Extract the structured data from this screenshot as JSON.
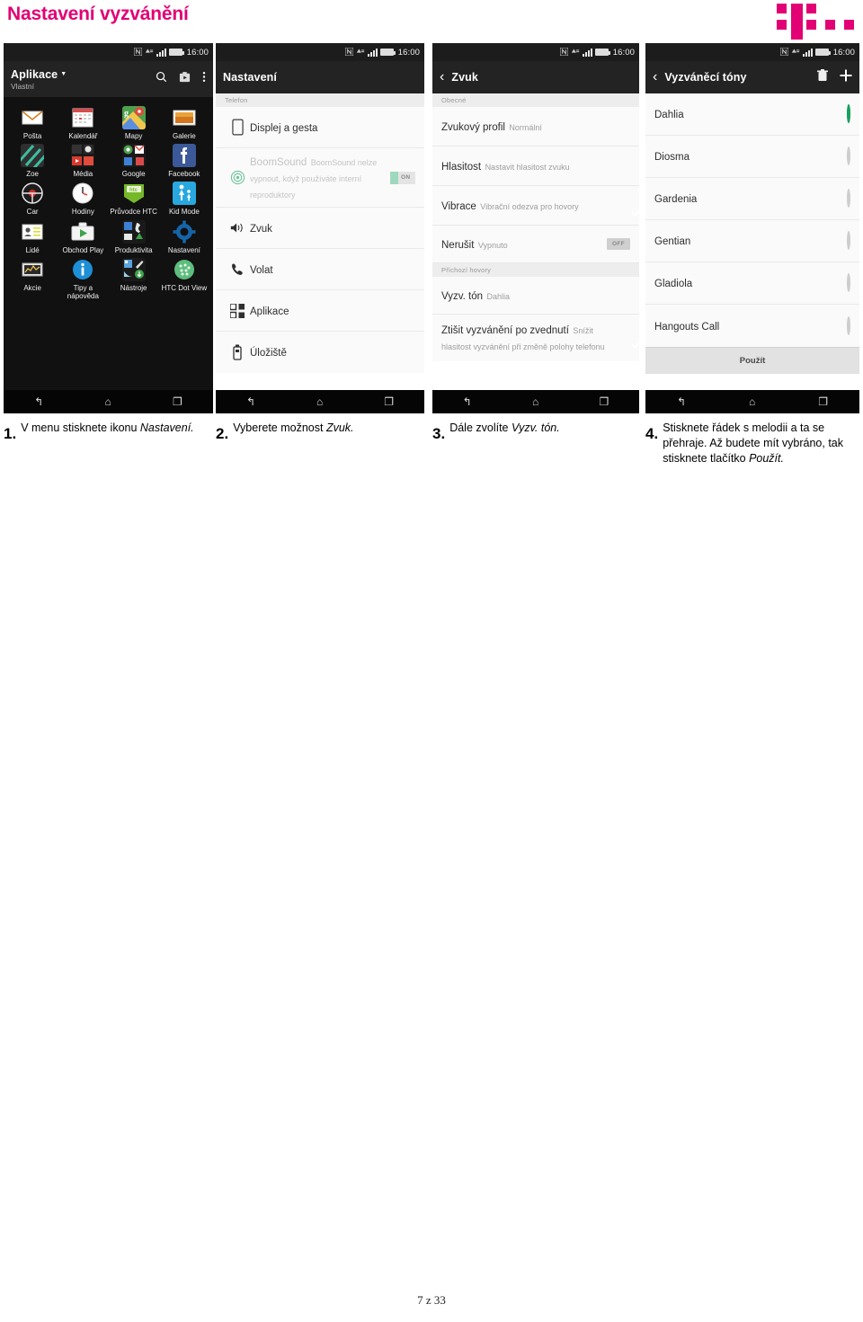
{
  "header": {
    "title": "Nastavení vyzvánění",
    "accent_color": "#e20074",
    "logo": "t-mobile-logo"
  },
  "phones": [
    {
      "id": "app-drawer",
      "statusbar": {
        "icons": [
          "nfc-icon",
          "data-icon",
          "signal-icon",
          "battery-icon"
        ],
        "time": "16:00"
      },
      "appbar": {
        "title": "Aplikace",
        "subtitle": "Vlastní",
        "dropdown_icon": "chevron-down-icon",
        "actions": [
          "search-icon",
          "play-store-icon",
          "overflow-menu-icon"
        ]
      },
      "apps": [
        {
          "label": "Pošta",
          "icon": "mail-icon"
        },
        {
          "label": "Kalendář",
          "icon": "calendar-icon"
        },
        {
          "label": "Mapy",
          "icon": "maps-icon"
        },
        {
          "label": "Galerie",
          "icon": "gallery-icon"
        },
        {
          "label": "Zoe",
          "icon": "zoe-icon"
        },
        {
          "label": "Média",
          "icon": "media-folder-icon"
        },
        {
          "label": "Google",
          "icon": "google-folder-icon"
        },
        {
          "label": "Facebook",
          "icon": "facebook-icon"
        },
        {
          "label": "Car",
          "icon": "car-icon"
        },
        {
          "label": "Hodiny",
          "icon": "clock-icon"
        },
        {
          "label": "Průvodce HTC",
          "icon": "htc-guide-icon"
        },
        {
          "label": "Kid Mode",
          "icon": "kid-mode-icon"
        },
        {
          "label": "Lidé",
          "icon": "people-icon"
        },
        {
          "label": "Obchod Play",
          "icon": "play-store-icon"
        },
        {
          "label": "Produktivita",
          "icon": "productivity-folder-icon"
        },
        {
          "label": "Nastavení",
          "icon": "gear-icon"
        },
        {
          "label": "Akcie",
          "icon": "stocks-icon"
        },
        {
          "label": "Tipy a nápověda",
          "icon": "info-icon"
        },
        {
          "label": "Nástroje",
          "icon": "tools-folder-icon"
        },
        {
          "label": "HTC Dot View",
          "icon": "dot-view-icon"
        }
      ],
      "navbar": [
        "back-icon",
        "home-icon",
        "recents-icon"
      ]
    },
    {
      "id": "settings",
      "statusbar": {
        "time": "16:00"
      },
      "appbar": {
        "title": "Nastavení"
      },
      "section": "Telefon",
      "rows": [
        {
          "title": "Displej a gesta",
          "sub": "",
          "icon": "phone-display-icon",
          "accessory": "none",
          "dim": false
        },
        {
          "title": "BoomSound",
          "sub": "BoomSound nelze vypnout, když používáte interní reproduktory",
          "icon": "boomsound-icon",
          "accessory": "toggle-on",
          "accessory_label": "ON",
          "dim": true
        },
        {
          "title": "Zvuk",
          "sub": "",
          "icon": "speaker-icon",
          "accessory": "none",
          "dim": false
        },
        {
          "title": "Volat",
          "sub": "",
          "icon": "phone-handset-icon",
          "accessory": "none",
          "dim": false
        },
        {
          "title": "Aplikace",
          "sub": "",
          "icon": "apps-grid-icon",
          "accessory": "none",
          "dim": false
        },
        {
          "title": "Úložiště",
          "sub": "",
          "icon": "storage-icon",
          "accessory": "none",
          "dim": false
        }
      ],
      "navbar": [
        "back-icon",
        "home-icon",
        "recents-icon"
      ]
    },
    {
      "id": "sound",
      "statusbar": {
        "time": "16:00"
      },
      "appbar": {
        "title": "Zvuk",
        "back_icon": "back-chevron-icon"
      },
      "sections": [
        {
          "label": "Obecné",
          "rows": [
            {
              "title": "Zvukový profil",
              "sub": "Normální",
              "accessory": "none"
            },
            {
              "title": "Hlasitost",
              "sub": "Nastavit hlasitost zvuku",
              "accessory": "none"
            },
            {
              "title": "Vibrace",
              "sub": "Vibrační odezva pro hovory",
              "accessory": "checkbox-checked"
            },
            {
              "title": "Nerušit",
              "sub": "Vypnuto",
              "accessory": "toggle-off",
              "accessory_label": "OFF"
            }
          ]
        },
        {
          "label": "Příchozí hovory",
          "rows": [
            {
              "title": "Vyzv. tón",
              "sub": "Dahlia",
              "accessory": "none"
            },
            {
              "title": "Ztišit vyzvánění po zvednutí",
              "sub": "Snížit hlasitost vyzvánění při změně polohy telefonu",
              "accessory": "checkbox-checked"
            }
          ]
        }
      ],
      "navbar": [
        "back-icon",
        "home-icon",
        "recents-icon"
      ]
    },
    {
      "id": "ringtones",
      "statusbar": {
        "time": "16:00"
      },
      "appbar": {
        "title": "Vyzváněcí tóny",
        "back_icon": "back-chevron-icon",
        "actions": [
          "trash-icon",
          "plus-icon"
        ]
      },
      "ringtones": [
        {
          "name": "Dahlia",
          "selected": true
        },
        {
          "name": "Diosma",
          "selected": false
        },
        {
          "name": "Gardenia",
          "selected": false
        },
        {
          "name": "Gentian",
          "selected": false
        },
        {
          "name": "Gladiola",
          "selected": false
        },
        {
          "name": "Hangouts Call",
          "selected": false
        }
      ],
      "apply_label": "Použít",
      "navbar": [
        "back-icon",
        "home-icon",
        "recents-icon"
      ]
    }
  ],
  "steps": [
    {
      "num": "1.",
      "text_html": "V menu stisknete ikonu <em>Nastavení.</em>"
    },
    {
      "num": "2.",
      "text_html": "Vyberete možnost <em>Zvuk.</em>"
    },
    {
      "num": "3.",
      "text_html": "Dále zvolíte <em>Vyzv. tón.</em>"
    },
    {
      "num": "4.",
      "text_html": "Stisknete řádek s melodii a ta se přehraje. Až budete mít vybráno, tak stisknete tlačítko <em>Použít.</em>"
    }
  ],
  "footer": {
    "page": "7 z 33"
  }
}
